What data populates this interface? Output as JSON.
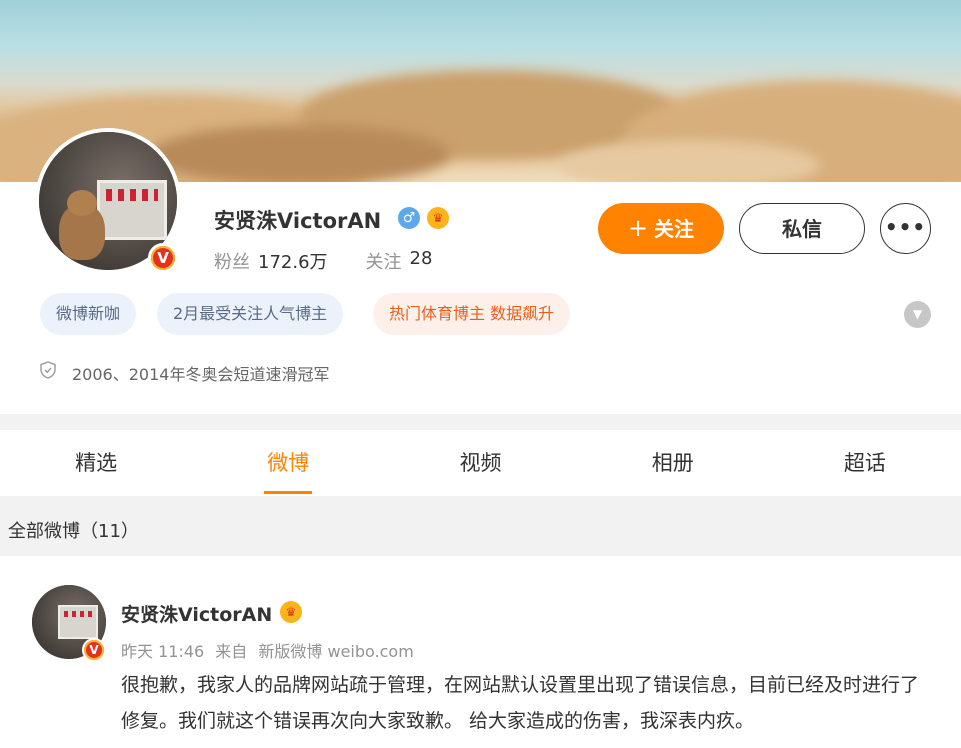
{
  "profile": {
    "name": "安贤洙VictorAN",
    "gender_icon": "male-icon",
    "badge_icon": "crown-icon",
    "verify_icon": "v-badge",
    "stats": {
      "followers_label": "粉丝",
      "followers_value": "172.6万",
      "following_label": "关注",
      "following_value": "28"
    },
    "buttons": {
      "follow": "关注",
      "message": "私信",
      "more": "•••"
    },
    "tags": [
      "微博新咖",
      "2月最受关注人气博主",
      "热门体育博主 数据飙升"
    ],
    "intro": "2006、2014年冬奥会短道速滑冠军"
  },
  "tabs": [
    "精选",
    "微博",
    "视频",
    "相册",
    "超话"
  ],
  "active_tab": "微博",
  "feed": {
    "count_label": "全部微博（11）"
  },
  "post": {
    "name": "安贤洙VictorAN",
    "time": "昨天 11:46",
    "source_prefix": "来自",
    "source": "新版微博 weibo.com",
    "text": "很抱歉，我家人的品牌网站疏于管理，在网站默认设置里出现了错误信息，目前已经及时进行了修复。我们就这个错误再次向大家致歉。 给大家造成的伤害，我深表内疚。"
  },
  "colors": {
    "accent": "#ff8200",
    "tag_blue_bg": "#ebf2fb",
    "tag_orange_bg": "#fdf0ea",
    "tag_orange_text": "#e8611c"
  }
}
